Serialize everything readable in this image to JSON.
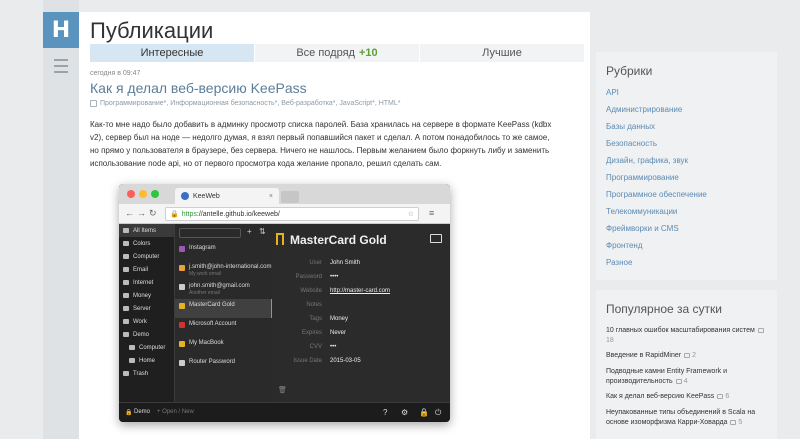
{
  "logo_letter": "H",
  "page_title": "Публикации",
  "tabs": [
    {
      "label": "Интересные"
    },
    {
      "label": "Все подряд",
      "badge": "+10"
    },
    {
      "label": "Лучшие"
    }
  ],
  "post": {
    "time": "сегодня в 09:47",
    "title": "Как я делал веб-версию KeePass",
    "hubs": "Программирование*, Информационная безопасность*, Веб-разработка*, JavaScript*, HTML*",
    "text": "Как-то мне надо было добавить в админку просмотр списка паролей. База хранилась на сервере в формате KeePass (kdbx v2), сервер был на ноде — недолго думая, я взял первый попавшийся пакет и сделал. А потом понадобилось то же самое, но прямо у пользователя в браузере, без сервера. Ничего не нашлось. Первым желанием было форкнуть либу и заменить использование node api, но от первого просмотра кода желание пропало, решил сделать сам."
  },
  "browser": {
    "tab_title": "KeeWeb",
    "url_https": "https",
    "url_rest": "://antelle.github.io/keeweb/",
    "sidebar": [
      {
        "label": "All Items"
      },
      {
        "label": "Colors"
      },
      {
        "label": "Computer"
      },
      {
        "label": "Email"
      },
      {
        "label": "Internet"
      },
      {
        "label": "Money"
      },
      {
        "label": "Server"
      },
      {
        "label": "Work"
      },
      {
        "label": "Demo"
      },
      {
        "label": "Computer"
      },
      {
        "label": "Home"
      },
      {
        "label": "Trash"
      }
    ],
    "entries": [
      {
        "title": "Instagram",
        "sub": "",
        "color": "#9b59b6"
      },
      {
        "title": "j.smith@john-international.com",
        "sub": "My work email",
        "color": "#e8a23a"
      },
      {
        "title": "john.smith@gmail.com",
        "sub": "Another email",
        "color": "#cccccc"
      },
      {
        "title": "MasterCard Gold",
        "sub": "",
        "color": "#e6b422"
      },
      {
        "title": "Microsoft Account",
        "sub": "",
        "color": "#cc3333"
      },
      {
        "title": "My MacBook",
        "sub": "",
        "color": "#e6b422"
      },
      {
        "title": "Router Password",
        "sub": "",
        "color": "#cccccc"
      }
    ],
    "detail": {
      "title": "MasterCard Gold",
      "fields": [
        {
          "label": "User",
          "value": "John Smith"
        },
        {
          "label": "Password",
          "value": "••••"
        },
        {
          "label": "Website",
          "value": "http://master-card.com"
        },
        {
          "label": "Notes",
          "value": ""
        },
        {
          "label": "Tags",
          "value": "Money"
        },
        {
          "label": "Expires",
          "value": "Never"
        },
        {
          "label": "CVV",
          "value": "•••"
        },
        {
          "label": "Issue Date",
          "value": "2015-03-05"
        }
      ]
    },
    "bottom_left": "Demo",
    "bottom_open": "+ Open / New"
  },
  "rubrics": {
    "heading": "Рубрики",
    "items": [
      "API",
      "Администрирование",
      "Базы данных",
      "Безопасность",
      "Дизайн, графика, звук",
      "Программирование",
      "Программное обеспечение",
      "Телекоммуникации",
      "Фреймворки и CMS",
      "Фронтенд",
      "Разное"
    ]
  },
  "popular": {
    "heading": "Популярное за сутки",
    "items": [
      {
        "title": "10 главных ошибок масштабирования систем",
        "count": "18"
      },
      {
        "title": "Введение в RapidMiner",
        "count": "2"
      },
      {
        "title": "Подводные камни Entity Framework и производительность",
        "count": "4"
      },
      {
        "title": "Как я делал веб-версию KeePass",
        "count": "6"
      },
      {
        "title": "Неупакованные типы объединений в Scala на основе изоморфизма Карри-Ховарда",
        "count": "5"
      }
    ]
  },
  "colors": {
    "accent": "#5a93bd",
    "link": "#5b8bb5",
    "active_tab": "#d6e6f2",
    "badge_green": "#5e9e37"
  }
}
